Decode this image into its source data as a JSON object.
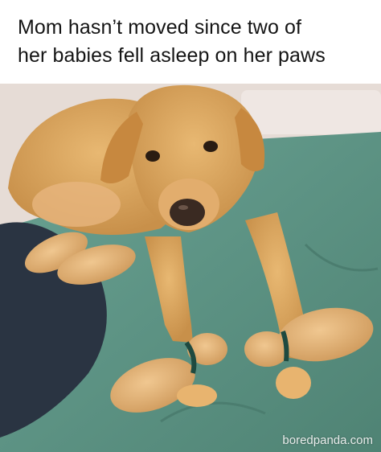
{
  "caption": {
    "line1": "Mom hasn’t moved since two of",
    "line2": "her babies fell asleep on her paws"
  },
  "photo": {
    "subject": "yellow labrador lying down with two newborn puppies asleep on her front paws",
    "colors": {
      "dog": "#d9a45e",
      "blanket": "#5f9484",
      "dark_blanket": "#2a3442",
      "collar": "#1e4a40"
    }
  },
  "watermark": {
    "text": "boredpanda.com"
  }
}
